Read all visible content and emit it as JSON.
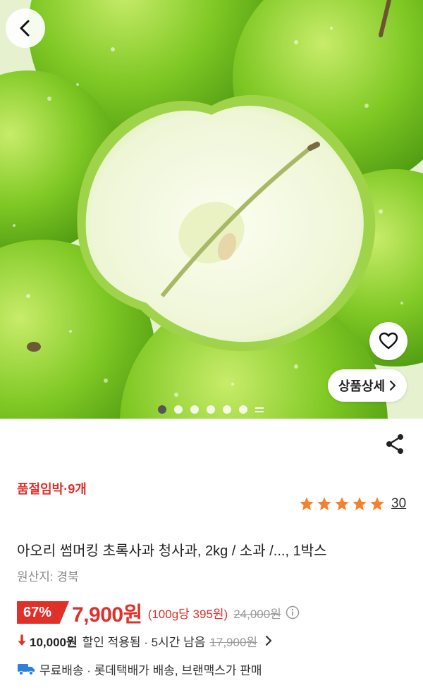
{
  "hero": {
    "image_alt": "청사과",
    "detail_button_label": "상품상세",
    "slide_count": 6,
    "active_slide": 1
  },
  "icons": {
    "back": "chevron-left-icon",
    "wishlist": "heart-icon",
    "share": "share-icon",
    "star": "star-icon",
    "info": "info-icon",
    "discount_arrow": "arrow-down-icon",
    "shipping": "truck-icon"
  },
  "product": {
    "stock_status": "품절임박·9개",
    "rating_value": 5,
    "review_count": "30",
    "title": "아오리 썸머킹 초록사과 청사과, 2kg / 소과 /..., 1박스",
    "origin": "원산지: 경북"
  },
  "price": {
    "discount_rate": "67%",
    "sale_price": "7,900원",
    "unit_price": "(100g당 395원)",
    "original_price": "24,000원"
  },
  "coupon": {
    "amount": "10,000원",
    "text": "할인 적용됨 · 5시간 남음",
    "before_price": "17,900원"
  },
  "shipping": {
    "text": "무료배송 · 롯데택배가 배송, 브랜맥스가 판매"
  },
  "colors": {
    "accent_red": "#e0302a",
    "star_orange": "#f5822a",
    "truck_blue": "#2f80d8"
  }
}
